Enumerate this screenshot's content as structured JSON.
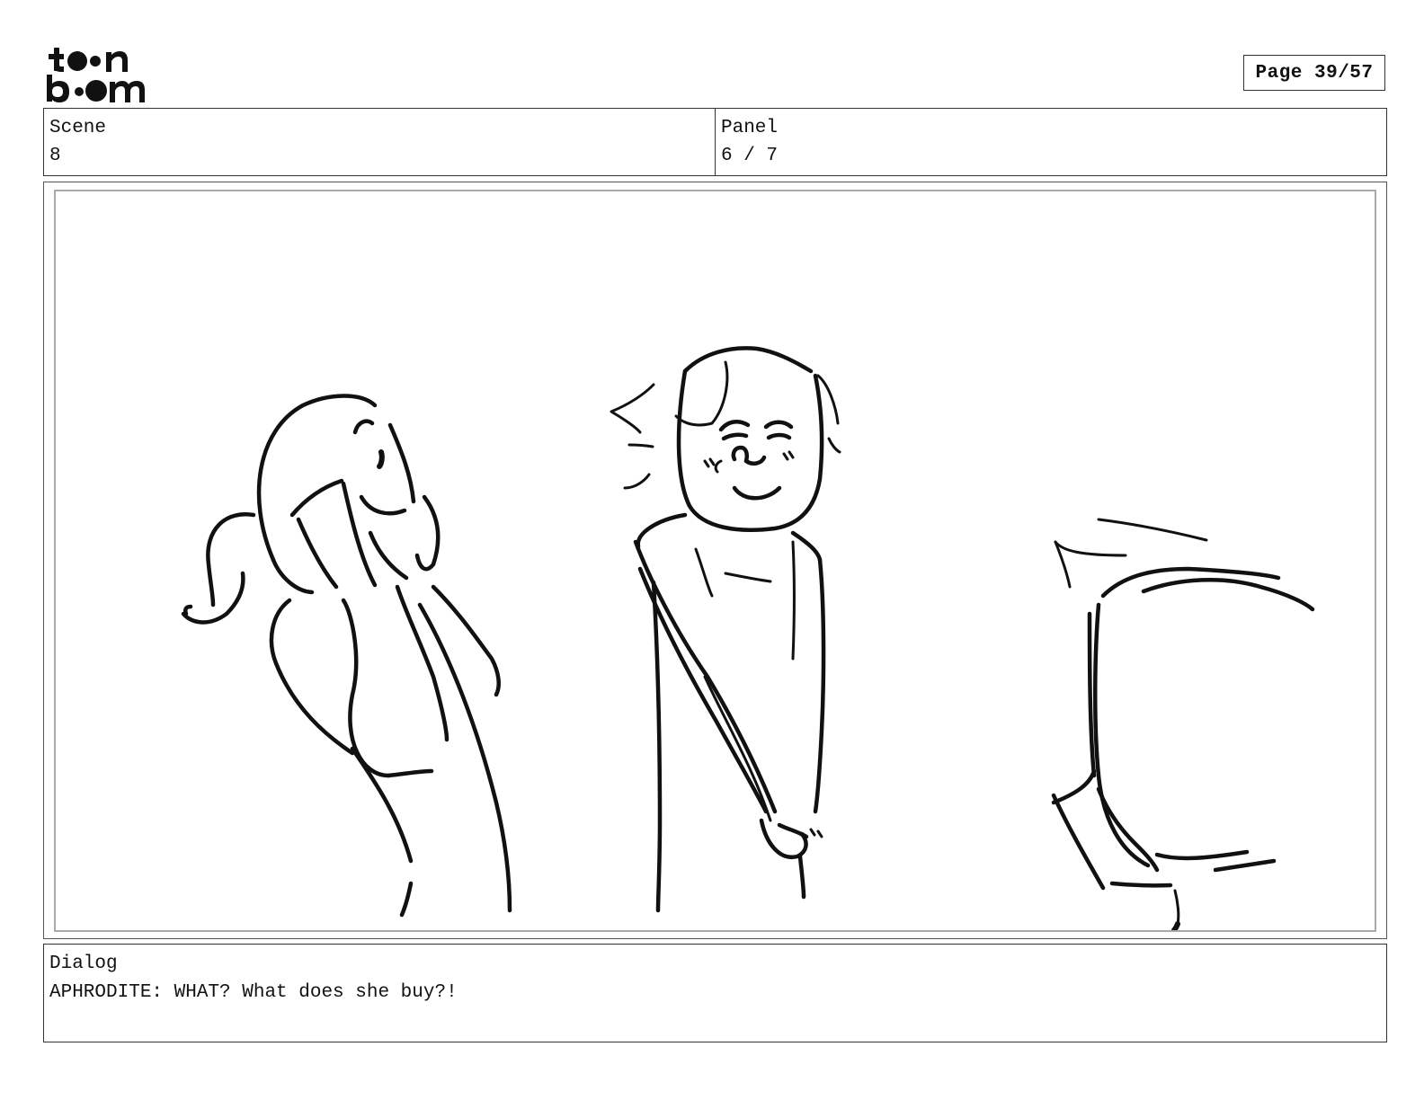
{
  "header": {
    "logo_name": "toon-boom-logo",
    "page_label": "Page 39/57"
  },
  "scene": {
    "label": "Scene",
    "value": "8"
  },
  "panel": {
    "label": "Panel",
    "value": "6 / 7"
  },
  "dialog": {
    "label": "Dialog",
    "text": "APHRODITE: WHAT? What does she buy?!"
  }
}
